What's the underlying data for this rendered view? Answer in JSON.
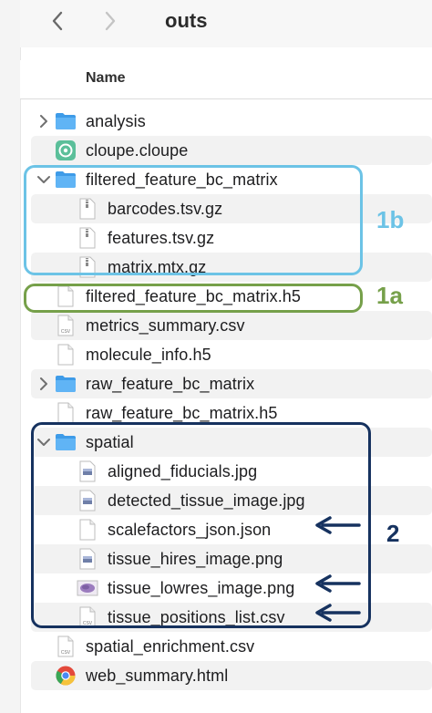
{
  "toolbar": {
    "title": "outs"
  },
  "header": {
    "name_label": "Name"
  },
  "rows": [
    {
      "label": "analysis",
      "icon": "folder-icon",
      "chevron": "right"
    },
    {
      "label": "cloupe.cloupe",
      "icon": "cloupe-app-icon"
    },
    {
      "label": "filtered_feature_bc_matrix",
      "icon": "folder-icon",
      "chevron": "down"
    },
    {
      "label": "barcodes.tsv.gz",
      "icon": "archive-file-icon"
    },
    {
      "label": "features.tsv.gz",
      "icon": "archive-file-icon"
    },
    {
      "label": "matrix.mtx.gz",
      "icon": "archive-file-icon"
    },
    {
      "label": "filtered_feature_bc_matrix.h5",
      "icon": "document-icon"
    },
    {
      "label": "metrics_summary.csv",
      "icon": "csv-file-icon"
    },
    {
      "label": "molecule_info.h5",
      "icon": "document-icon"
    },
    {
      "label": "raw_feature_bc_matrix",
      "icon": "folder-icon",
      "chevron": "right"
    },
    {
      "label": "raw_feature_bc_matrix.h5",
      "icon": "document-icon"
    },
    {
      "label": "spatial",
      "icon": "folder-icon",
      "chevron": "down"
    },
    {
      "label": "aligned_fiducials.jpg",
      "icon": "image-file-icon"
    },
    {
      "label": "detected_tissue_image.jpg",
      "icon": "image-file-icon"
    },
    {
      "label": "scalefactors_json.json",
      "icon": "document-icon"
    },
    {
      "label": "tissue_hires_image.png",
      "icon": "image-file-icon"
    },
    {
      "label": "tissue_lowres_image.png",
      "icon": "tissue-thumbnail-icon"
    },
    {
      "label": "tissue_positions_list.csv",
      "icon": "csv-file-icon"
    },
    {
      "label": "spatial_enrichment.csv",
      "icon": "csv-file-icon"
    },
    {
      "label": "web_summary.html",
      "icon": "chrome-html-icon"
    }
  ],
  "annotations": {
    "label_1b": "1b",
    "label_1a": "1a",
    "label_2": "2",
    "color_1b": "#6cc3e6",
    "color_1a": "#76a04a",
    "color_2": "#16325f"
  }
}
